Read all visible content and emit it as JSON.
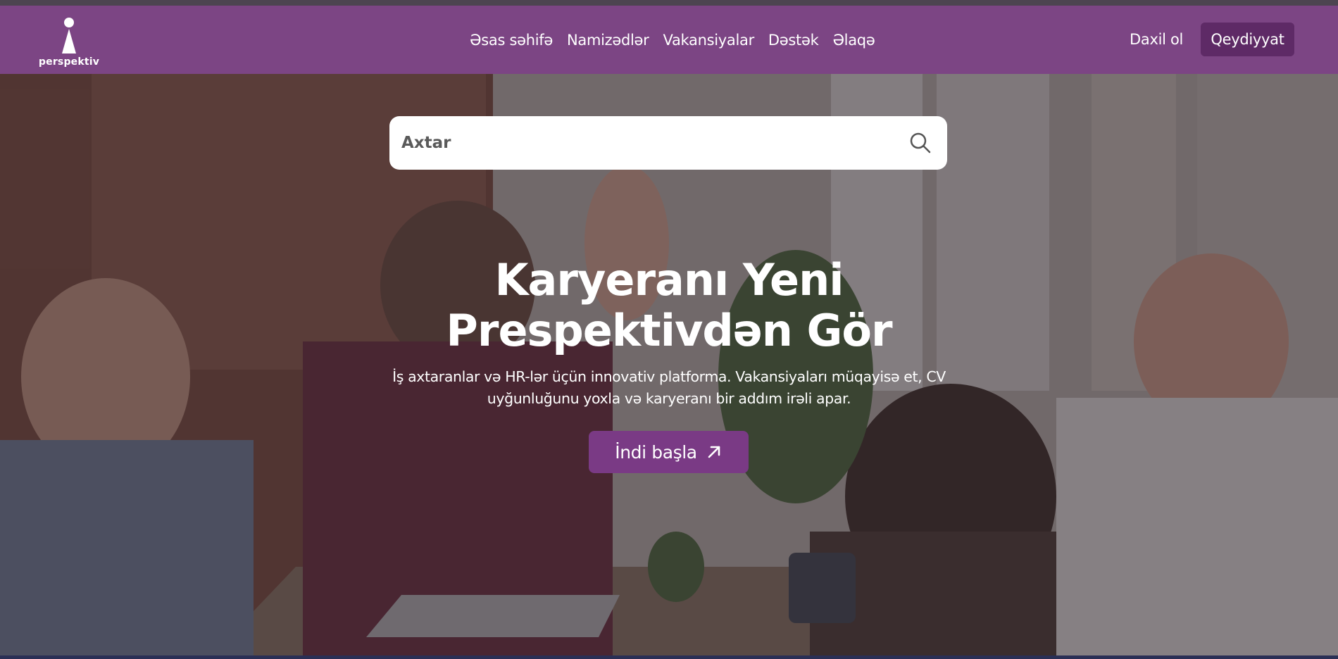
{
  "brand": {
    "name": "perspektiv"
  },
  "nav": {
    "links": [
      "Əsas səhifə",
      "Namizədlər",
      "Vakansiyalar",
      "Dəstək",
      "Əlaqə"
    ],
    "login_label": "Daxil ol",
    "register_label": "Qeydiyyat"
  },
  "search": {
    "placeholder": "Axtar"
  },
  "hero": {
    "title_line1": "Karyeranı Yeni",
    "title_line2": "Prespektivdən Gör",
    "subtitle_line1": "İş axtaranlar və HR-lər üçün innovativ platforma. Vakansiyaları müqayisə et, CV",
    "subtitle_line2": "uyğunluğunu yoxla və karyeranı bir addım irəli apar.",
    "cta_label": "İndi başla"
  },
  "colors": {
    "navbar": "#7c4584",
    "register_button": "#5e2a66",
    "cta_button": "#7a3a85",
    "text_on_dark": "#ffffff"
  },
  "icons": {
    "logo": "keyhole-person-icon",
    "search": "search-icon",
    "cta_arrow": "arrow-up-right-icon"
  }
}
